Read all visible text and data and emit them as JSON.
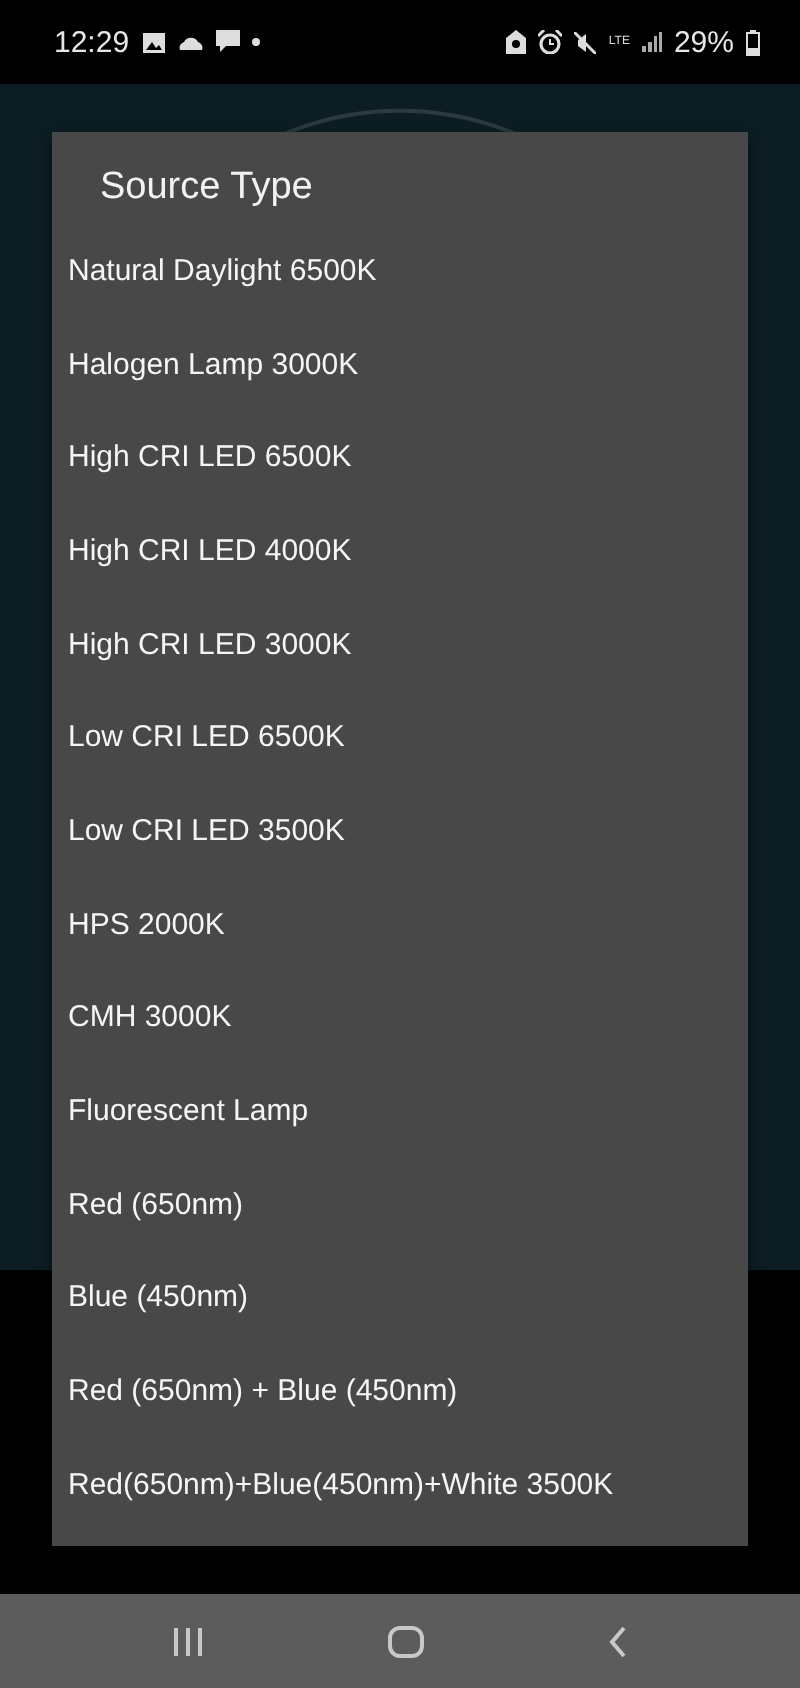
{
  "status_bar": {
    "time": "12:29",
    "network": "LTE",
    "battery": "29%"
  },
  "dialog": {
    "title": "Source Type",
    "options": [
      "Natural Daylight 6500K",
      "Halogen Lamp 3000K",
      "High CRI LED 6500K",
      "High CRI LED 4000K",
      "High CRI LED 3000K",
      "Low CRI LED 6500K",
      "Low CRI LED 3500K",
      "HPS 2000K",
      "CMH 3000K",
      "Fluorescent Lamp",
      "Red (650nm)",
      "Blue (450nm)",
      "Red (650nm) + Blue (450nm)",
      "Red(650nm)+Blue(450nm)+White 3500K"
    ]
  }
}
